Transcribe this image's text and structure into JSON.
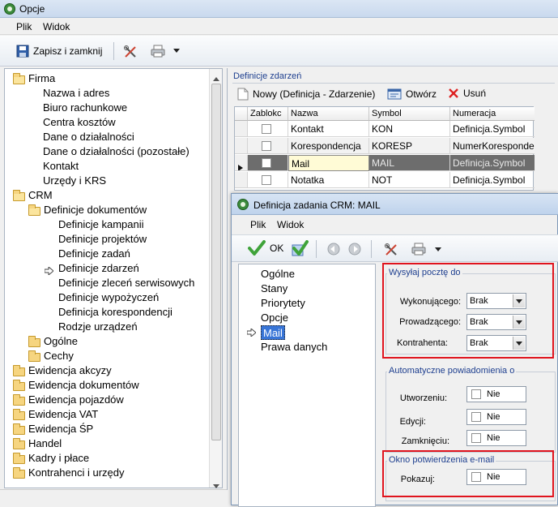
{
  "window": {
    "title": "Opcje"
  },
  "menu": [
    "Plik",
    "Widok"
  ],
  "toolbar": {
    "save_label": "Zapisz i zamknij"
  },
  "tree": {
    "items": [
      {
        "label": "Firma",
        "level": 0,
        "type": "folder-open"
      },
      {
        "label": "Nazwa i adres",
        "level": 1
      },
      {
        "label": "Biuro rachunkowe",
        "level": 1
      },
      {
        "label": "Centra kosztów",
        "level": 1
      },
      {
        "label": "Dane o działalności",
        "level": 1
      },
      {
        "label": "Dane o działalności (pozostałe)",
        "level": 1
      },
      {
        "label": "Kontakt",
        "level": 1
      },
      {
        "label": "Urzędy i KRS",
        "level": 1
      },
      {
        "label": "CRM",
        "level": 0,
        "type": "folder-open"
      },
      {
        "label": "Definicje dokumentów",
        "level": 1,
        "type": "folder-open"
      },
      {
        "label": "Definicje kampanii",
        "level": 2
      },
      {
        "label": "Definicje projektów",
        "level": 2
      },
      {
        "label": "Definicje zadań",
        "level": 2
      },
      {
        "label": "Definicje zdarzeń",
        "level": 2,
        "selected": true
      },
      {
        "label": "Definicje zleceń serwisowych",
        "level": 2
      },
      {
        "label": "Definicje wypożyczeń",
        "level": 2
      },
      {
        "label": "Definicja korespondencji",
        "level": 2
      },
      {
        "label": "Rodzje urządzeń",
        "level": 2
      },
      {
        "label": "Ogólne",
        "level": 1,
        "type": "folder"
      },
      {
        "label": "Cechy",
        "level": 1,
        "type": "folder"
      },
      {
        "label": "Ewidencja akcyzy",
        "level": 0,
        "type": "folder"
      },
      {
        "label": "Ewidencja dokumentów",
        "level": 0,
        "type": "folder"
      },
      {
        "label": "Ewidencja pojazdów",
        "level": 0,
        "type": "folder"
      },
      {
        "label": "Ewidencja VAT",
        "level": 0,
        "type": "folder"
      },
      {
        "label": "Ewidencja ŚP",
        "level": 0,
        "type": "folder"
      },
      {
        "label": "Handel",
        "level": 0,
        "type": "folder"
      },
      {
        "label": "Kadry i płace",
        "level": 0,
        "type": "folder"
      },
      {
        "label": "Kontrahenci i urzędy",
        "level": 0,
        "type": "folder"
      }
    ]
  },
  "panel": {
    "title": "Definicje zdarzeń",
    "new_label": "Nowy (Definicja - Zdarzenie)",
    "open_label": "Otwórz",
    "delete_label": "Usuń",
    "columns": [
      "Zablokc",
      "Nazwa",
      "Symbol",
      "Numeracja"
    ],
    "rows": [
      {
        "nazwa": "Kontakt",
        "symbol": "KON",
        "numeracja": "Definicja.Symbol"
      },
      {
        "nazwa": "Korespondencja",
        "symbol": "KORESP",
        "numeracja": "NumerKorespondencji"
      },
      {
        "nazwa": "Mail",
        "symbol": "MAIL",
        "numeracja": "Definicja.Symbol"
      },
      {
        "nazwa": "Notatka",
        "symbol": "NOT",
        "numeracja": "Definicja.Symbol"
      }
    ]
  },
  "dialog": {
    "title": "Definicja zadania CRM: MAIL",
    "menu": [
      "Plik",
      "Widok"
    ],
    "ok_label": "OK",
    "nav": [
      "Ogólne",
      "Stany",
      "Priorytety",
      "Opcje",
      "Mail",
      "Prawa danych"
    ],
    "selected_nav": "Mail",
    "send_group": {
      "title": "Wysyłaj pocztę do",
      "fields": [
        {
          "label": "Wykonującego:",
          "value": "Brak"
        },
        {
          "label": "Prowadzącego:",
          "value": "Brak"
        },
        {
          "label": "Kontrahenta:",
          "value": "Brak"
        }
      ]
    },
    "auto_group": {
      "title": "Automatyczne powiadomienia o",
      "fields": [
        {
          "label": "Utworzeniu:",
          "value": "Nie"
        },
        {
          "label": "Edycji:",
          "value": "Nie"
        },
        {
          "label": "Zamknięciu:",
          "value": "Nie"
        }
      ]
    },
    "confirm_group": {
      "title": "Okno potwierdzenia e-mail",
      "fields": [
        {
          "label": "Pokazuj:",
          "value": "Nie"
        }
      ]
    }
  },
  "colors": {
    "highlight": "#e0141e",
    "selected_row": "#6d6d6d",
    "accent": "#1e3f8f"
  }
}
